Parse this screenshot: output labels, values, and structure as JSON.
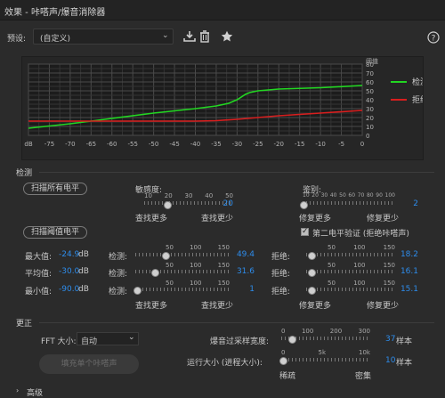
{
  "window": {
    "title": "效果 - 咔嗒声/爆音消除器"
  },
  "preset": {
    "label": "预设:",
    "value": "(自定义)"
  },
  "icons": {
    "save": "save-download-icon",
    "delete": "trash-icon",
    "favorite": "star-icon",
    "help": "help-circle-icon"
  },
  "colors": {
    "detect": "#22d622",
    "reject": "#d81e1e",
    "accent": "#2d8ceb",
    "background": "#2b2b2b"
  },
  "graph": {
    "y_axis_title": "阈值",
    "y_ticks": [
      "80",
      "70",
      "60",
      "50",
      "40",
      "30",
      "20",
      "10",
      "0"
    ],
    "x_ticks": [
      "dB",
      "-75",
      "-70",
      "-65",
      "-60",
      "-55",
      "-50",
      "-45",
      "-40",
      "-35",
      "-30",
      "-25",
      "-20",
      "-15",
      "-10",
      "-5",
      "0"
    ],
    "legend": [
      {
        "name": "检测",
        "color": "#22d622"
      },
      {
        "name": "拒绝",
        "color": "#d81e1e"
      }
    ]
  },
  "chart_data": {
    "type": "line",
    "xlabel": "dB",
    "ylabel": "阈值",
    "xlim": [
      -80,
      0
    ],
    "ylim": [
      0,
      80
    ],
    "grid": true,
    "legend_placement": "right",
    "series": [
      {
        "name": "检测",
        "color": "#22d622",
        "x": [
          -80,
          -70,
          -60,
          -50,
          -40,
          -35,
          -32,
          -30,
          -28,
          -27,
          -25,
          -20,
          -10,
          0
        ],
        "y": [
          8,
          13,
          19,
          25,
          30,
          33,
          36,
          40,
          46,
          48,
          50,
          52,
          53.5,
          56
        ]
      },
      {
        "name": "拒绝",
        "color": "#d81e1e",
        "x": [
          -80,
          -70,
          -60,
          -50,
          -40,
          -35,
          -30,
          -25,
          -20,
          -10,
          0
        ],
        "y": [
          16,
          16,
          16,
          16,
          16,
          16.5,
          18,
          20,
          22,
          25,
          28
        ]
      }
    ]
  },
  "detection": {
    "title": "检测",
    "scan_all_btn": "扫描所有电平",
    "scan_threshold_btn": "扫描阈值电平",
    "sensitivity": {
      "label": "敏感度:",
      "scale": [
        "10",
        "20",
        "30",
        "40",
        "50"
      ],
      "value": "20",
      "left": "查找更多",
      "right": "查找更少"
    },
    "discrimination": {
      "label": "鉴别:",
      "scale": [
        "10",
        "20",
        "30",
        "40",
        "50",
        "60",
        "70",
        "80",
        "90",
        "100"
      ],
      "value": "2",
      "left": "修复更多",
      "right": "修复更少"
    },
    "second_level_check": "第二电平验证 (拒绝咔嗒声)",
    "rows": [
      {
        "label": "最大值:",
        "level": "-24.9",
        "unit": "dB",
        "detect_label": "检测:",
        "detect_scale": [
          "50",
          "100",
          "150"
        ],
        "detect_value": "49.4",
        "reject_label": "拒绝:",
        "reject_scale": [
          "50",
          "100",
          "150"
        ],
        "reject_value": "18.2"
      },
      {
        "label": "平均值:",
        "level": "-30.0",
        "unit": "dB",
        "detect_label": "检测:",
        "detect_scale": [
          "50",
          "100",
          "150"
        ],
        "detect_value": "31.6",
        "reject_label": "拒绝:",
        "reject_scale": [
          "50",
          "100",
          "150"
        ],
        "reject_value": "16.1"
      },
      {
        "label": "最小值:",
        "level": "-90.0",
        "unit": "dB",
        "detect_label": "检测:",
        "detect_scale": [
          "50",
          "100",
          "150"
        ],
        "detect_value": "1",
        "reject_label": "拒绝:",
        "reject_scale": [
          "50",
          "100",
          "150"
        ],
        "reject_value": "15.1"
      }
    ],
    "detect_more": "查找更多",
    "detect_less": "查找更少",
    "reject_more": "修复更多",
    "reject_less": "修复更少"
  },
  "correction": {
    "title": "更正",
    "fft_label": "FFT 大小:",
    "fft_value": "自动",
    "learn_btn": "填充单个咔嗒声",
    "oversample": {
      "label": "爆音过采样宽度:",
      "scale": [
        "0",
        "100",
        "200",
        "300"
      ],
      "value": "37",
      "unit": "样本"
    },
    "run_size": {
      "label": "运行大小 (进程大小):",
      "scale": [
        "0",
        "5k",
        "10k"
      ],
      "value": "10",
      "unit": "样本",
      "left": "稀疏",
      "right": "密集"
    }
  },
  "advanced": {
    "title": "高级"
  }
}
